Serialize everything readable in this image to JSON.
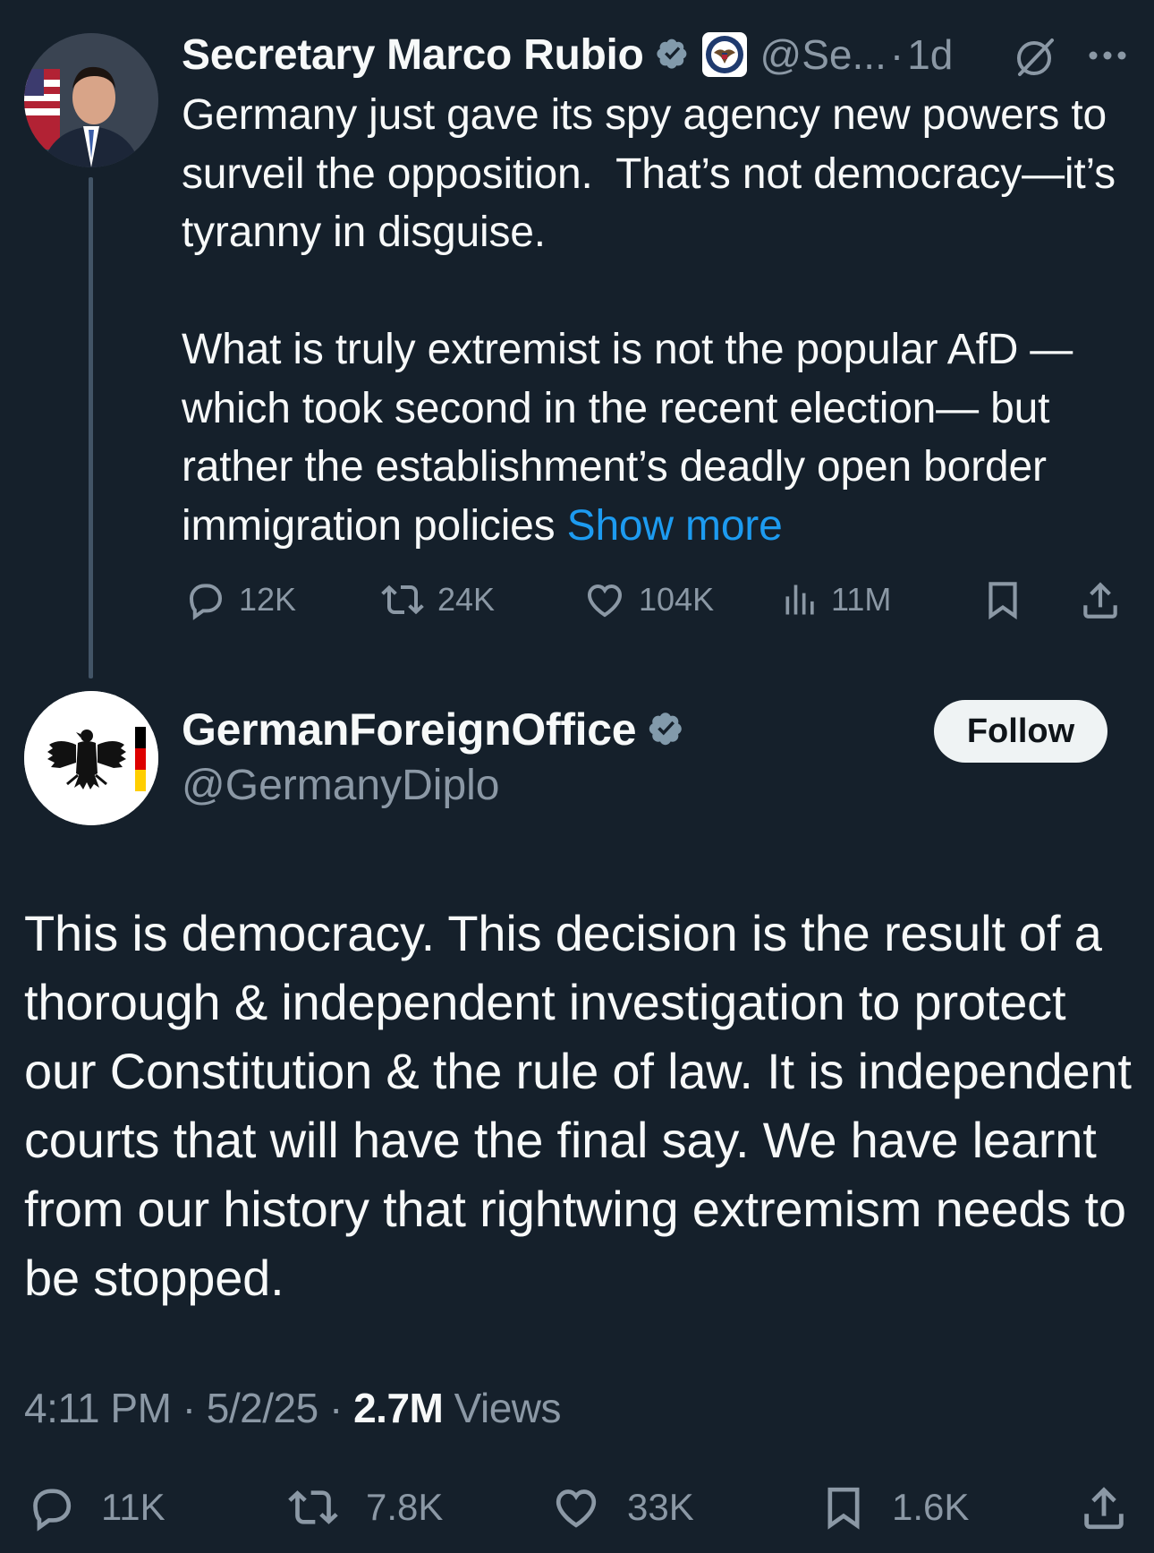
{
  "tweet1": {
    "author_name": "Secretary Marco Rubio",
    "handle": "@Se...",
    "separator": "·",
    "time": "1d",
    "text": "Germany just gave its spy agency new powers to surveil the opposition.  That’s not democracy—it’s tyranny in disguise.\n\nWhat is truly extremist is not the popular AfD —which took second in the recent election— but rather the establishment’s deadly open border immigration policies ",
    "show_more": "Show more",
    "stats": {
      "replies": "12K",
      "reposts": "24K",
      "likes": "104K",
      "views": "11M"
    }
  },
  "tweet2": {
    "author_name": "GermanForeignOffice",
    "handle": "@GermanyDiplo",
    "follow_label": "Follow",
    "text": "This is democracy. This decision is the result of a thorough & independent investigation to protect our Constitution & the rule of law. It is independent courts that will have the final say. We have learnt from our history that rightwing extremism needs to be stopped.",
    "time": "4:11 PM",
    "date": "5/2/25",
    "sep": "·",
    "views_count": "2.7M",
    "views_label": "Views",
    "stats": {
      "replies": "11K",
      "reposts": "7.8K",
      "likes": "33K",
      "bookmarks": "1.6K"
    }
  },
  "colors": {
    "background": "#15202b",
    "text": "#f7f9f9",
    "secondary": "#8b98a5",
    "link": "#1d9bf0",
    "verified_badge": "#829aab"
  }
}
